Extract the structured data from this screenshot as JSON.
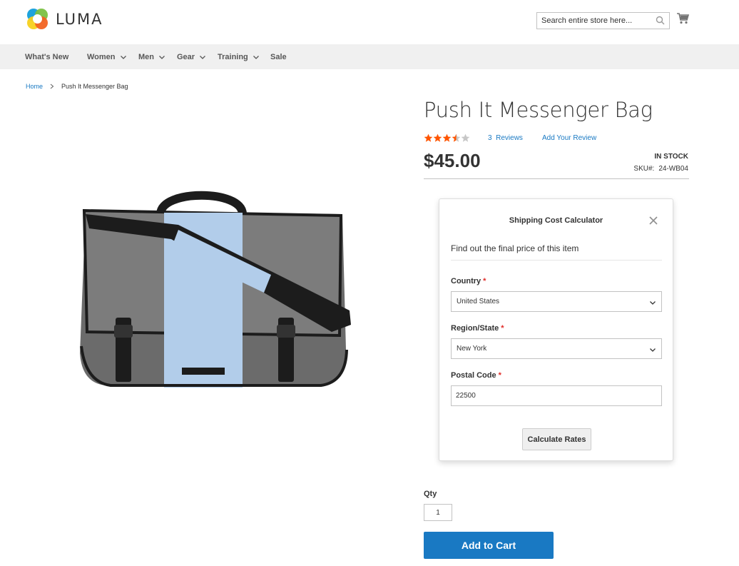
{
  "header": {
    "logo_text": "LUMA",
    "search_placeholder": "Search entire store here...",
    "icons": [
      "search-icon",
      "cart-icon"
    ]
  },
  "nav": {
    "items": [
      {
        "label": "What's New",
        "has_dropdown": false
      },
      {
        "label": "Women",
        "has_dropdown": true
      },
      {
        "label": "Men",
        "has_dropdown": true
      },
      {
        "label": "Gear",
        "has_dropdown": true
      },
      {
        "label": "Training",
        "has_dropdown": true
      },
      {
        "label": "Sale",
        "has_dropdown": false
      }
    ]
  },
  "breadcrumb": {
    "home": "Home",
    "current": "Push It Messenger Bag"
  },
  "product": {
    "title": "Push It Messenger Bag",
    "rating_stars": 3.5,
    "rating_max": 5,
    "reviews_count": "3",
    "reviews_label": "Reviews",
    "add_review": "Add Your Review",
    "price": "$45.00",
    "stock": "IN STOCK",
    "sku_label": "SKU#:",
    "sku_value": "24-WB04"
  },
  "shipping_modal": {
    "title": "Shipping Cost Calculator",
    "subtitle": "Find out the final price of this item",
    "country_label": "Country",
    "country_value": "United States",
    "region_label": "Region/State",
    "region_value": "New York",
    "postal_label": "Postal Code",
    "postal_value": "22500",
    "required_mark": "*",
    "calculate_button": "Calculate Rates"
  },
  "purchase": {
    "qty_label": "Qty",
    "qty_value": "1",
    "add_to_cart": "Add to Cart"
  },
  "colors": {
    "accent": "#1979c3",
    "star": "#ff5501",
    "required": "#e02b27",
    "nav_bg": "#f0f0f0"
  }
}
